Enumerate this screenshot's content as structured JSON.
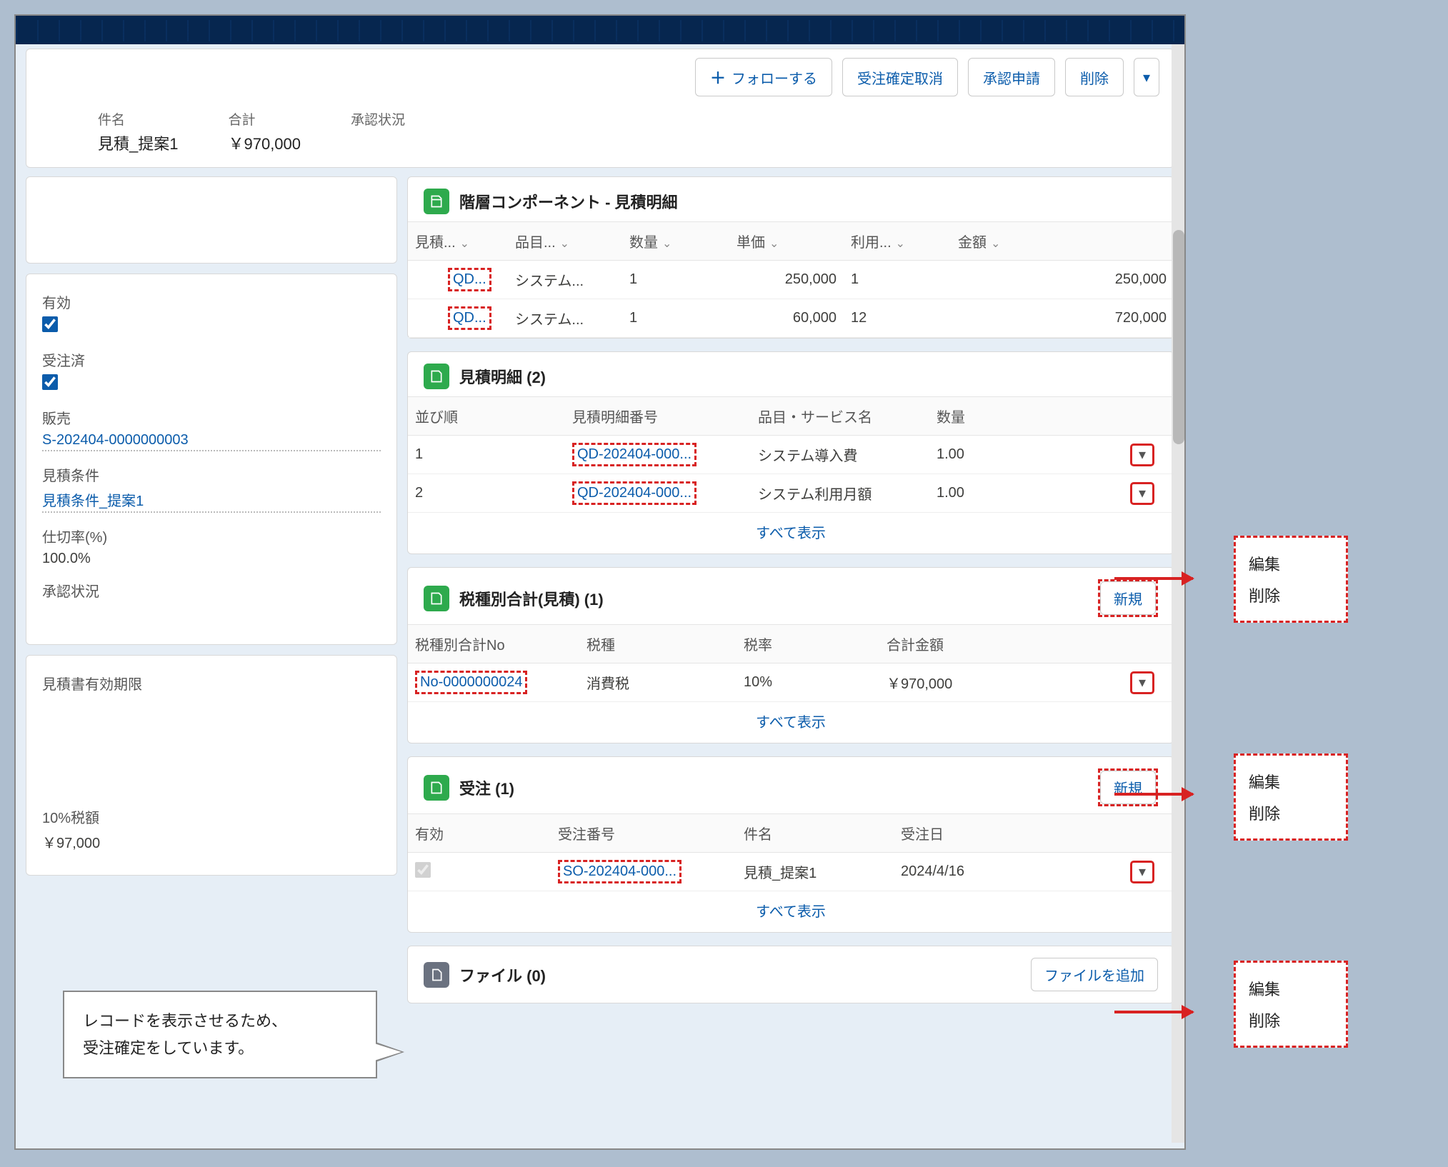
{
  "actions": {
    "follow": "フォローする",
    "cancel_confirm": "受注確定取消",
    "submit_approval": "承認申請",
    "delete": "削除"
  },
  "header_fields": {
    "subject_label": "件名",
    "subject_value": "見積_提案1",
    "total_label": "合計",
    "total_value": "￥970,000",
    "approval_label": "承認状況"
  },
  "detail": {
    "active_label": "有効",
    "ordered_label": "受注済",
    "sales_label": "販売",
    "sales_value": "S-202404-0000000003",
    "cond_label": "見積条件",
    "cond_value": "見積条件_提案1",
    "margin_label": "仕切率(%)",
    "margin_value": "100.0%",
    "approval_label": "承認状況",
    "valid_label": "見積書有効期限",
    "tax10_label": "10%税額",
    "tax10_value": "￥97,000"
  },
  "hier": {
    "title": "階層コンポーネント - 見積明細",
    "cols": {
      "c1": "見積...",
      "c2": "品目...",
      "c3": "数量",
      "c4": "単価",
      "c5": "利用...",
      "c6": "金額"
    },
    "rows": [
      {
        "id": "QD...",
        "name": "システム...",
        "qty": "1",
        "unit": "250,000",
        "use": "1",
        "amt": "250,000"
      },
      {
        "id": "QD...",
        "name": "システム...",
        "qty": "1",
        "unit": "60,000",
        "use": "12",
        "amt": "720,000"
      }
    ]
  },
  "qdetail": {
    "title": "見積明細 (2)",
    "cols": {
      "order": "並び順",
      "no": "見積明細番号",
      "item": "品目・サービス名",
      "qty": "数量"
    },
    "rows": [
      {
        "order": "1",
        "no": "QD-202404-000...",
        "item": "システム導入費",
        "qty": "1.00"
      },
      {
        "order": "2",
        "no": "QD-202404-000...",
        "item": "システム利用月額",
        "qty": "1.00"
      }
    ],
    "showall": "すべて表示"
  },
  "taxsum": {
    "title": "税種別合計(見積) (1)",
    "new": "新規",
    "cols": {
      "no": "税種別合計No",
      "type": "税種",
      "rate": "税率",
      "total": "合計金額"
    },
    "row": {
      "no": "No-0000000024",
      "type": "消費税",
      "rate": "10%",
      "total": "￥970,000"
    },
    "showall": "すべて表示"
  },
  "orders": {
    "title": "受注 (1)",
    "new": "新規",
    "cols": {
      "active": "有効",
      "no": "受注番号",
      "subject": "件名",
      "date": "受注日"
    },
    "row": {
      "no": "SO-202404-000...",
      "subject": "見積_提案1",
      "date": "2024/4/16"
    },
    "showall": "すべて表示"
  },
  "files": {
    "title": "ファイル (0)",
    "add": "ファイルを追加"
  },
  "callout": {
    "l1": "レコードを表示させるため、",
    "l2": "受注確定をしています。"
  },
  "menu": {
    "edit": "編集",
    "del": "削除"
  }
}
